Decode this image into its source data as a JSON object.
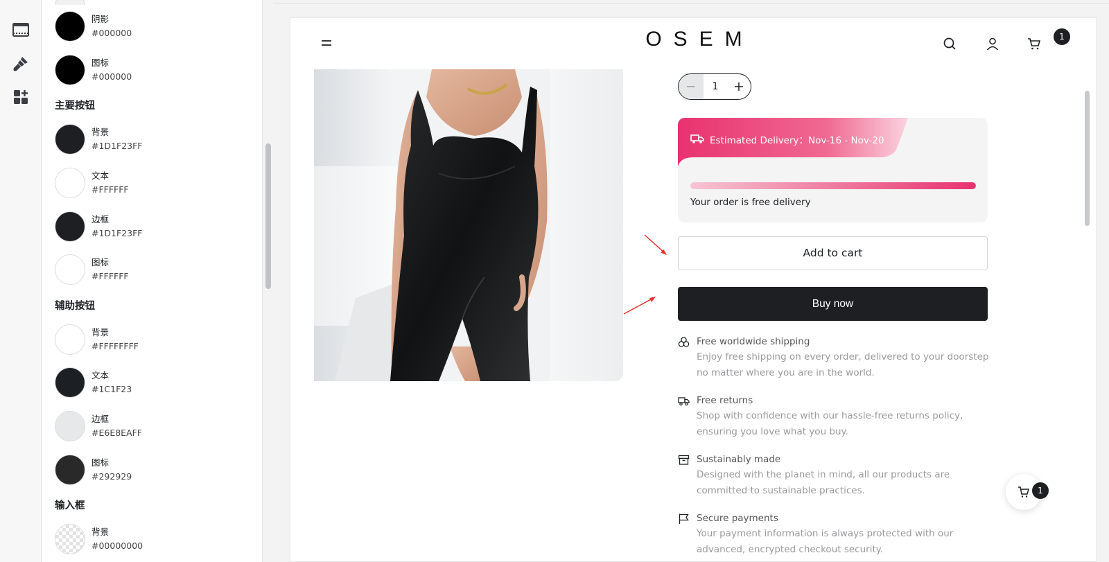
{
  "rail": {
    "items": [
      {
        "icon": "layout-section-icon"
      },
      {
        "icon": "paint-brush-icon"
      },
      {
        "icon": "add-block-icon"
      }
    ]
  },
  "panel": {
    "top_items": [
      {
        "label": "阴影",
        "hex": "#000000",
        "color": "#000000"
      },
      {
        "label": "图标",
        "hex": "#000000",
        "color": "#000000"
      }
    ],
    "primary_button": {
      "title": "主要按钮",
      "items": [
        {
          "label": "背景",
          "hex": "#1D1F23FF",
          "color": "#1D1F23"
        },
        {
          "label": "文本",
          "hex": "#FFFFFF",
          "color": "#FFFFFF"
        },
        {
          "label": "边框",
          "hex": "#1D1F23FF",
          "color": "#1D1F23"
        },
        {
          "label": "图标",
          "hex": "#FFFFFF",
          "color": "#FFFFFF"
        }
      ]
    },
    "secondary_button": {
      "title": "辅助按钮",
      "items": [
        {
          "label": "背景",
          "hex": "#FFFFFFFF",
          "color": "#FFFFFF"
        },
        {
          "label": "文本",
          "hex": "#1C1F23",
          "color": "#1C1F23"
        },
        {
          "label": "边框",
          "hex": "#E6E8EAFF",
          "color": "#E6E8EA"
        },
        {
          "label": "图标",
          "hex": "#292929",
          "color": "#292929"
        }
      ]
    },
    "input": {
      "title": "输入框",
      "items": [
        {
          "label": "背景",
          "hex": "#00000000",
          "color": "transparent"
        }
      ]
    }
  },
  "store": {
    "logo": "OSEM",
    "cart_count": "1",
    "quantity": "1",
    "delivery": {
      "estimate": "Estimated Delivery：Nov-16 - Nov-20",
      "progress": 1.0,
      "note": "Your order is free delivery"
    },
    "add_to_cart": "Add to cart",
    "buy_now": "Buy now",
    "features": [
      {
        "icon": "globe-shipping-icon",
        "title": "Free worldwide shipping",
        "desc": "Enjoy free shipping on every order, delivered to your doorstep no matter where you are in the world."
      },
      {
        "icon": "truck-icon",
        "title": "Free returns",
        "desc": "Shop with confidence with our hassle-free returns policy, ensuring you love what you buy."
      },
      {
        "icon": "archive-box-icon",
        "title": "Sustainably made",
        "desc": "Designed with the planet in mind, all our products are committed to sustainable practices."
      },
      {
        "icon": "flag-icon",
        "title": "Secure payments",
        "desc": "Your payment information is always protected with our advanced, encrypted checkout security."
      }
    ],
    "floating_cart_count": "1"
  },
  "colors": {
    "accent_pink": "#E8326F",
    "button_dark": "#1D1F23",
    "annotation_arrow": "#E5322D"
  }
}
